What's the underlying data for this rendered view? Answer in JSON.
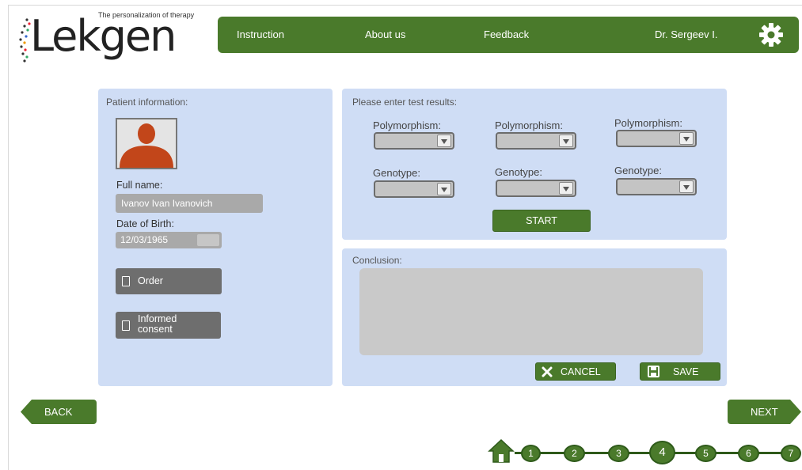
{
  "logo": {
    "tagline": "The personalization of therapy",
    "word": "Lekgen"
  },
  "nav": {
    "items": [
      "Instruction",
      "About us",
      "Feedback",
      "Dr. Sergeev I."
    ],
    "settings_icon": "gear-icon"
  },
  "patient": {
    "section_label": "Patient information:",
    "full_name_label": "Full name:",
    "full_name_value": "Ivanov Ivan Ivanovich",
    "dob_label": "Date of Birth:",
    "dob_value": "12/03/1965",
    "order_label": "Order",
    "consent_label": "Informed consent"
  },
  "tests": {
    "section_label": "Please enter test results:",
    "polymorphism_label": "Polymorphism:",
    "genotype_label": "Genotype:",
    "start_label": "START"
  },
  "conclusion": {
    "section_label": "Conclusion:",
    "cancel_label": "CANCEL",
    "save_label": "SAVE"
  },
  "navigation": {
    "back_label": "BACK",
    "next_label": "NEXT",
    "steps": [
      "1",
      "2",
      "3",
      "4",
      "5",
      "6",
      "7"
    ],
    "current_step": "4"
  },
  "colors": {
    "accent_green": "#4a7a2b",
    "panel_blue": "#cfddf5",
    "avatar_orange": "#c2461a"
  }
}
